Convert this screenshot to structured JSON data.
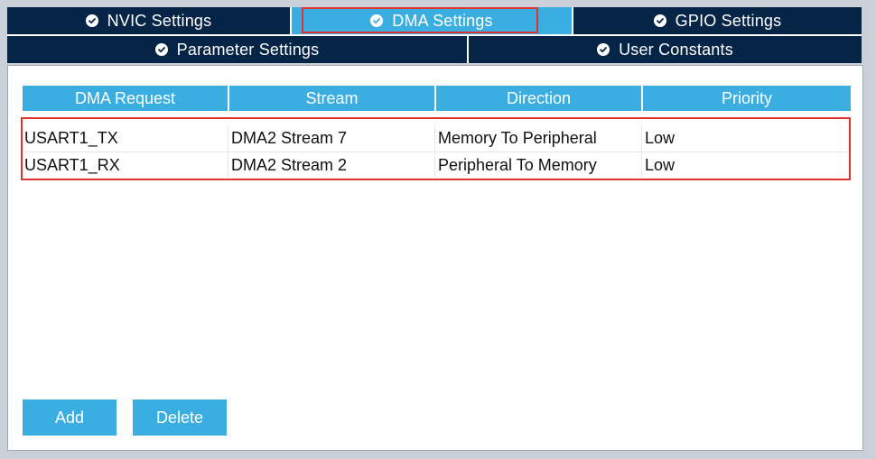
{
  "tabs": {
    "row1": [
      {
        "label": "NVIC Settings",
        "active": false
      },
      {
        "label": "DMA Settings",
        "active": true
      },
      {
        "label": "GPIO Settings",
        "active": false
      }
    ],
    "row2": [
      {
        "label": "Parameter Settings",
        "active": false
      },
      {
        "label": "User Constants",
        "active": false
      }
    ]
  },
  "table": {
    "headers": [
      "DMA Request",
      "Stream",
      "Direction",
      "Priority"
    ],
    "rows": [
      [
        "USART1_TX",
        "DMA2 Stream 7",
        "Memory To Peripheral",
        "Low"
      ],
      [
        "USART1_RX",
        "DMA2 Stream 2",
        "Peripheral To Memory",
        "Low"
      ]
    ]
  },
  "buttons": {
    "add_label": "Add",
    "delete_label": "Delete"
  },
  "colors": {
    "tab_dark": "#062446",
    "accent": "#3aaee0",
    "highlight": "#e0332f"
  },
  "icons": {
    "tab_status": "check-circle-icon"
  }
}
